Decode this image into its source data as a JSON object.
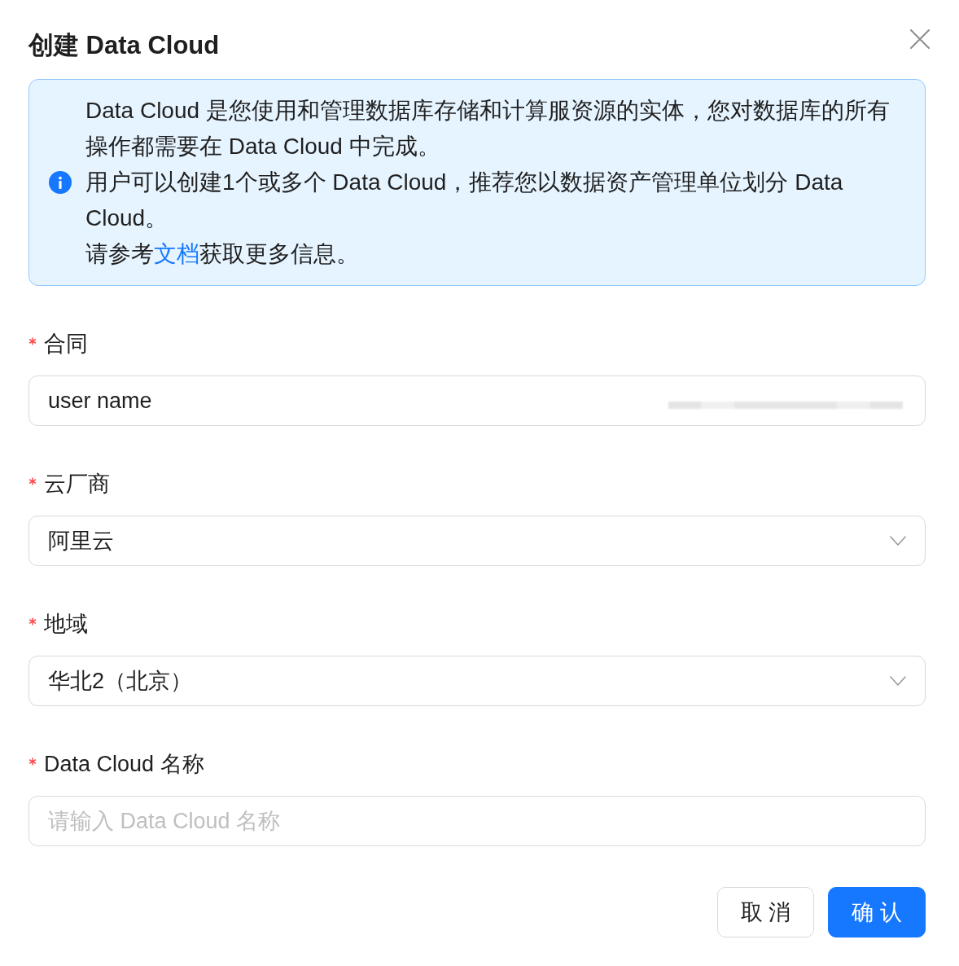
{
  "dialog": {
    "title": "创建 Data Cloud"
  },
  "alert": {
    "paragraphs": [
      "Data Cloud 是您使用和管理数据库存储和计算服资源的实体，您对数据库的所有操作都需要在 Data Cloud 中完成。",
      "用户可以创建1个或多个 Data Cloud，推荐您以数据资产管理单位划分 Data Cloud。"
    ],
    "note": {
      "before": "请参考",
      "link": "文档",
      "after": "获取更多信息。"
    }
  },
  "fields": [
    {
      "label": "合同",
      "required": true,
      "kind": "input",
      "value": "user name",
      "redacted": true
    },
    {
      "label": "云厂商",
      "required": true,
      "kind": "select",
      "value": "阿里云",
      "redacted": false
    },
    {
      "label": "地域",
      "required": true,
      "kind": "select",
      "value": "华北2（北京）",
      "redacted": false
    },
    {
      "label": "Data Cloud 名称",
      "required": true,
      "kind": "input",
      "placeholder": "请输入 Data Cloud 名称",
      "redacted": false
    }
  ],
  "buttons": [
    {
      "label": "取 消",
      "kind": "default"
    },
    {
      "label": "确 认",
      "kind": "primary"
    }
  ]
}
